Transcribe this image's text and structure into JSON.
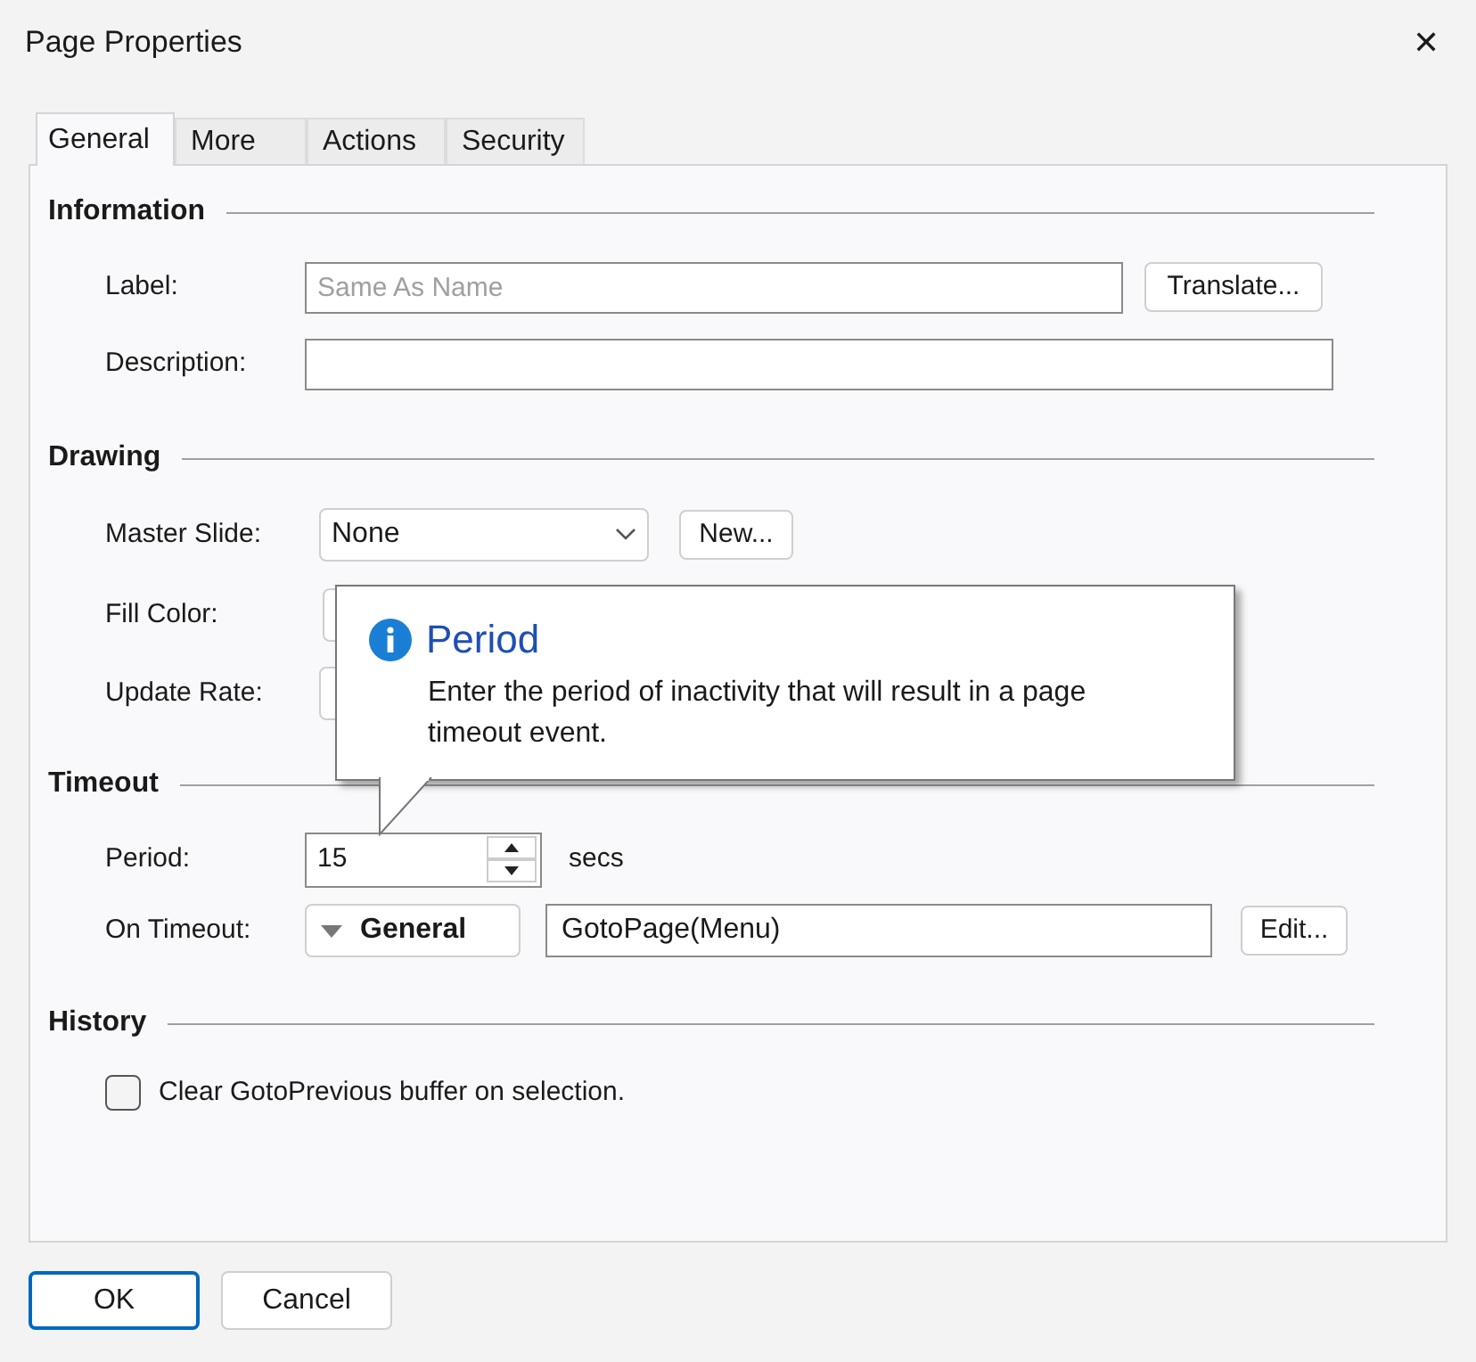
{
  "window": {
    "title": "Page Properties",
    "close": "✕"
  },
  "tabs": [
    {
      "label": "General",
      "selected": true
    },
    {
      "label": "More",
      "selected": false
    },
    {
      "label": "Actions",
      "selected": false
    },
    {
      "label": "Security",
      "selected": false
    }
  ],
  "information": {
    "heading": "Information",
    "label_caption": "Label:",
    "label_placeholder": "Same As Name",
    "translate_button": "Translate...",
    "description_caption": "Description:"
  },
  "drawing": {
    "heading": "Drawing",
    "master_slide_caption": "Master Slide:",
    "master_slide_value": "None",
    "new_button": "New...",
    "fill_color_caption": "Fill Color:",
    "update_rate_caption": "Update Rate:"
  },
  "timeout": {
    "heading": "Timeout",
    "period_caption": "Period:",
    "period_value": "15",
    "period_unit": "secs",
    "on_timeout_caption": "On Timeout:",
    "action_type": "General",
    "action_value": "GotoPage(Menu)",
    "edit_button": "Edit..."
  },
  "history": {
    "heading": "History",
    "clear_label": "Clear GotoPrevious buffer on selection.",
    "checked": false
  },
  "tooltip": {
    "title": "Period",
    "text": "Enter the period of inactivity that will result in a page timeout event."
  },
  "buttons": [
    {
      "label": "OK",
      "selected": true
    },
    {
      "label": "Cancel",
      "selected": false
    }
  ]
}
